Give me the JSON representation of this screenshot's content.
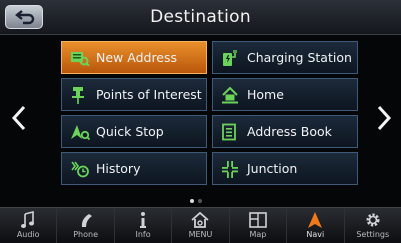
{
  "header": {
    "title": "Destination",
    "back_icon": "back-arrow-icon"
  },
  "arrows": {
    "left": "chevron-left-icon",
    "right": "chevron-right-icon"
  },
  "menu": {
    "items": [
      {
        "label": "New Address",
        "icon": "new-address-icon",
        "selected": true
      },
      {
        "label": "Charging Station",
        "icon": "charging-station-icon",
        "selected": false
      },
      {
        "label": "Points of Interest",
        "icon": "pin-icon",
        "selected": false
      },
      {
        "label": "Home",
        "icon": "home-icon",
        "selected": false
      },
      {
        "label": "Quick Stop",
        "icon": "quick-stop-icon",
        "selected": false
      },
      {
        "label": "Address Book",
        "icon": "address-book-icon",
        "selected": false
      },
      {
        "label": "History",
        "icon": "history-icon",
        "selected": false
      },
      {
        "label": "Junction",
        "icon": "junction-icon",
        "selected": false
      }
    ]
  },
  "pagination": {
    "pages": 2,
    "current": 1
  },
  "bottom_nav": [
    {
      "label": "Audio",
      "icon": "music-note-icon"
    },
    {
      "label": "Phone",
      "icon": "phone-icon"
    },
    {
      "label": "Info",
      "icon": "info-icon"
    },
    {
      "label": "MENU",
      "icon": "menu-home-icon"
    },
    {
      "label": "Map",
      "icon": "map-icon"
    },
    {
      "label": "Navi",
      "icon": "navi-arrow-icon",
      "active": true
    },
    {
      "label": "Settings",
      "icon": "gear-icon"
    }
  ],
  "colors": {
    "selected_tile": "#d9741a",
    "tile_border": "#3d5a7a",
    "icon_green": "#6cd35a",
    "icon_navi": "#f07a1a"
  }
}
